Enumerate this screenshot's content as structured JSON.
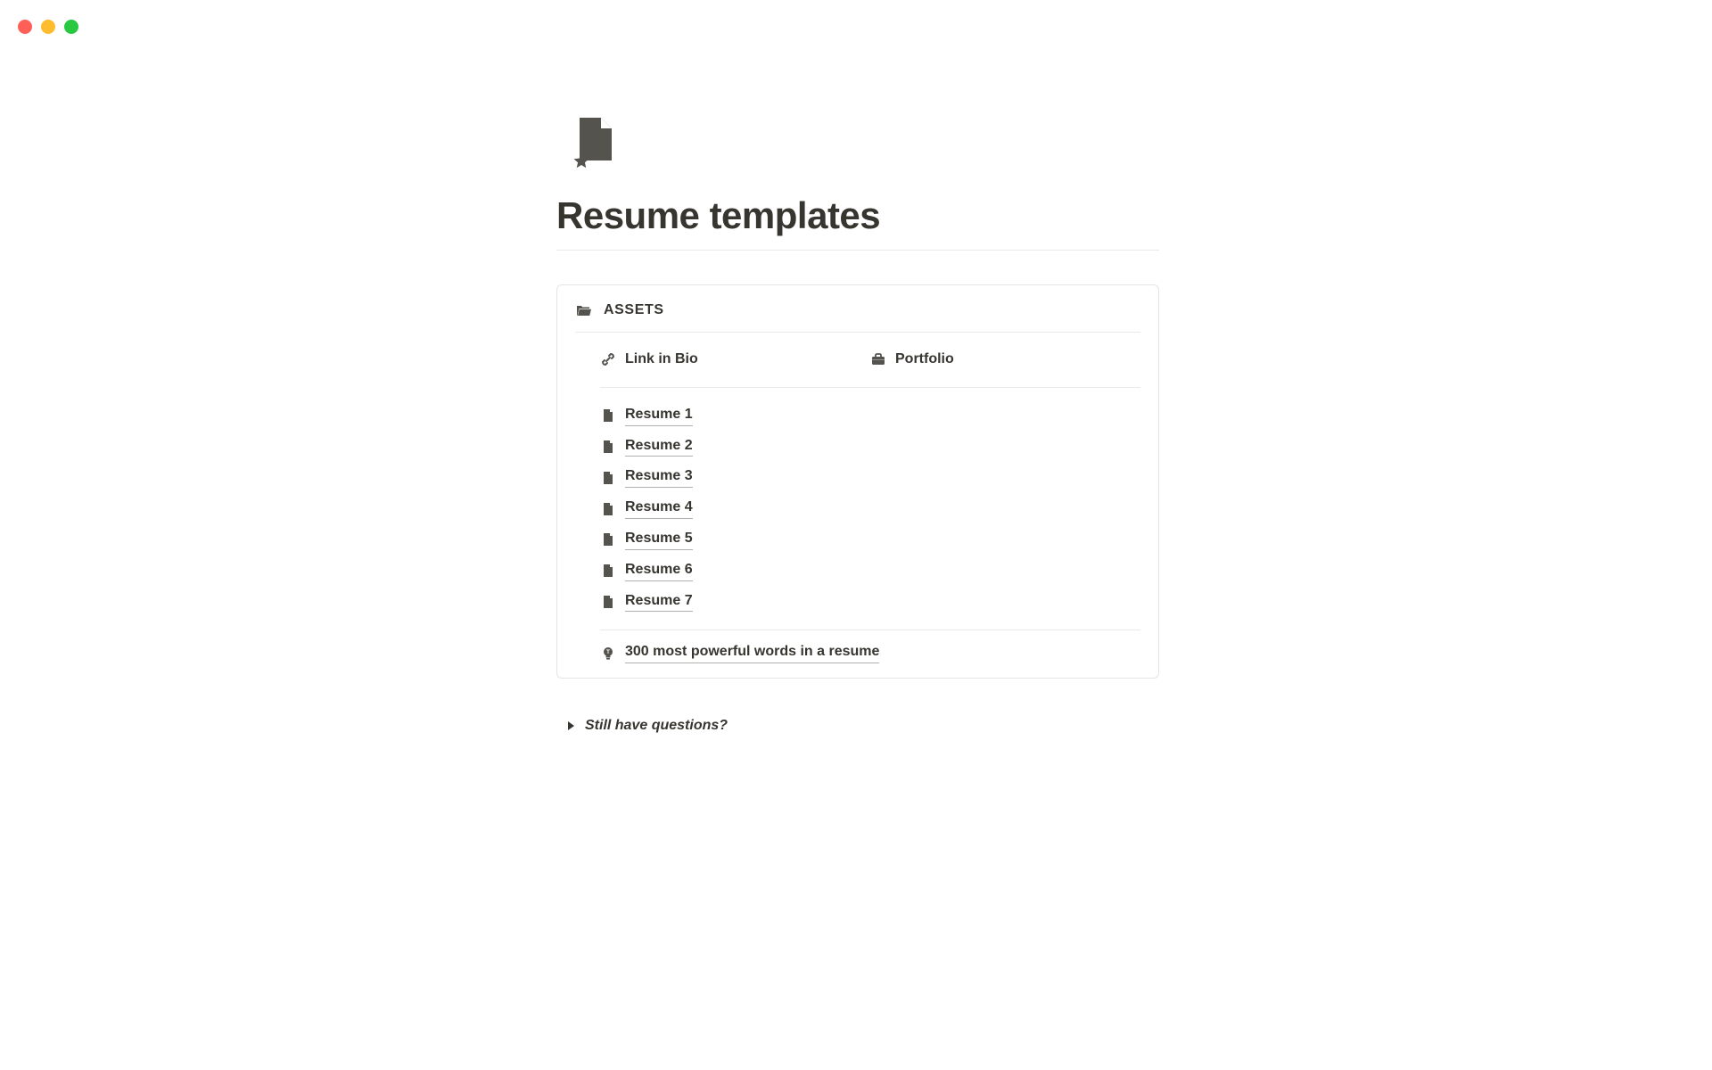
{
  "page": {
    "title": "Resume templates"
  },
  "assets": {
    "heading": "ASSETS",
    "top_links": [
      {
        "label": "Link in Bio"
      },
      {
        "label": "Portfolio"
      }
    ],
    "resumes": [
      {
        "label": "Resume 1"
      },
      {
        "label": "Resume 2"
      },
      {
        "label": "Resume 3"
      },
      {
        "label": "Resume 4"
      },
      {
        "label": "Resume 5"
      },
      {
        "label": "Resume 6"
      },
      {
        "label": "Resume 7"
      }
    ],
    "tip": {
      "label": "300 most powerful words in a resume"
    }
  },
  "toggle": {
    "label": "Still have questions?"
  }
}
